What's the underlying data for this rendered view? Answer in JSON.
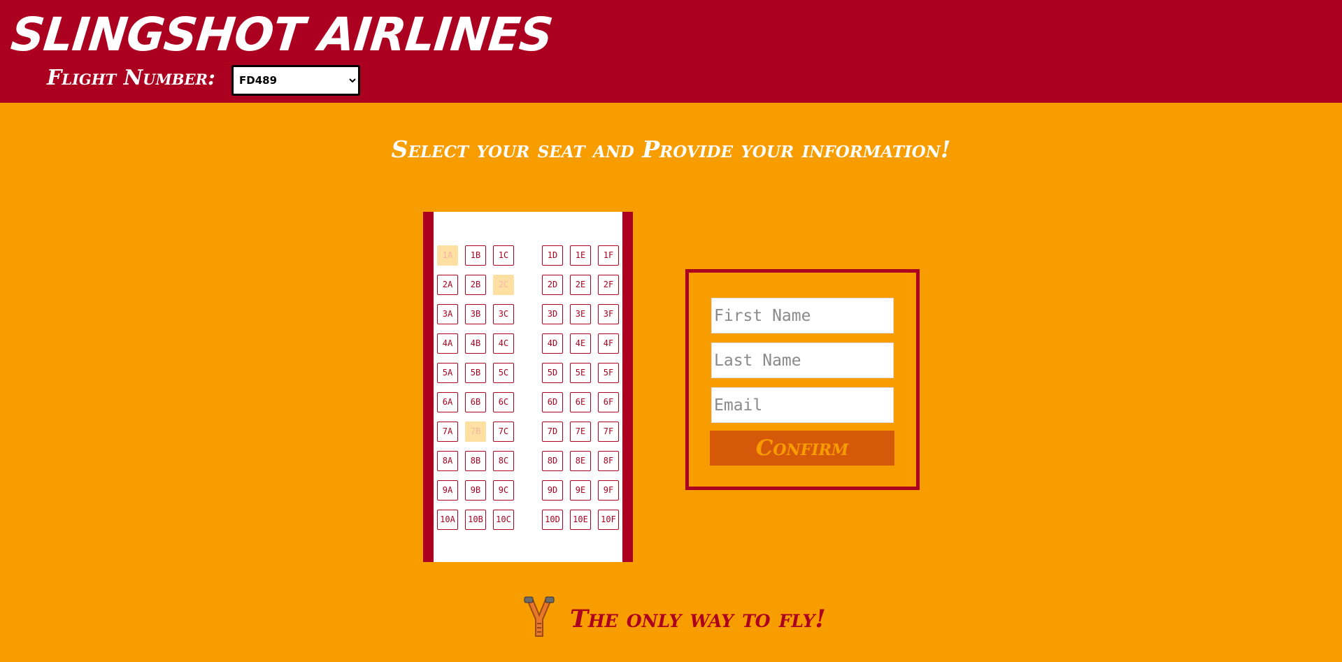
{
  "header": {
    "brand": "SLINGSHOT AIRLINES",
    "flight_label": "Flight Number:",
    "flight_selected": "FD489"
  },
  "main": {
    "subtitle": "Select your seat and Provide your information!"
  },
  "seat_map": {
    "rows": [
      "1",
      "2",
      "3",
      "4",
      "5",
      "6",
      "7",
      "8",
      "9",
      "10"
    ],
    "columns": [
      "A",
      "B",
      "C",
      "D",
      "E",
      "F"
    ],
    "unavailable": [
      "1A",
      "2C",
      "7B"
    ]
  },
  "form": {
    "first_name_placeholder": "First Name",
    "last_name_placeholder": "Last Name",
    "email_placeholder": "Email",
    "confirm_label": "Confirm"
  },
  "footer": {
    "tagline": "The only way to fly!",
    "icon": "slingshot-icon"
  },
  "colors": {
    "brand_red": "#ab001f",
    "background_orange": "#f89d00",
    "button_orange": "#d6590a",
    "taken_seat": "#fde0a2"
  }
}
